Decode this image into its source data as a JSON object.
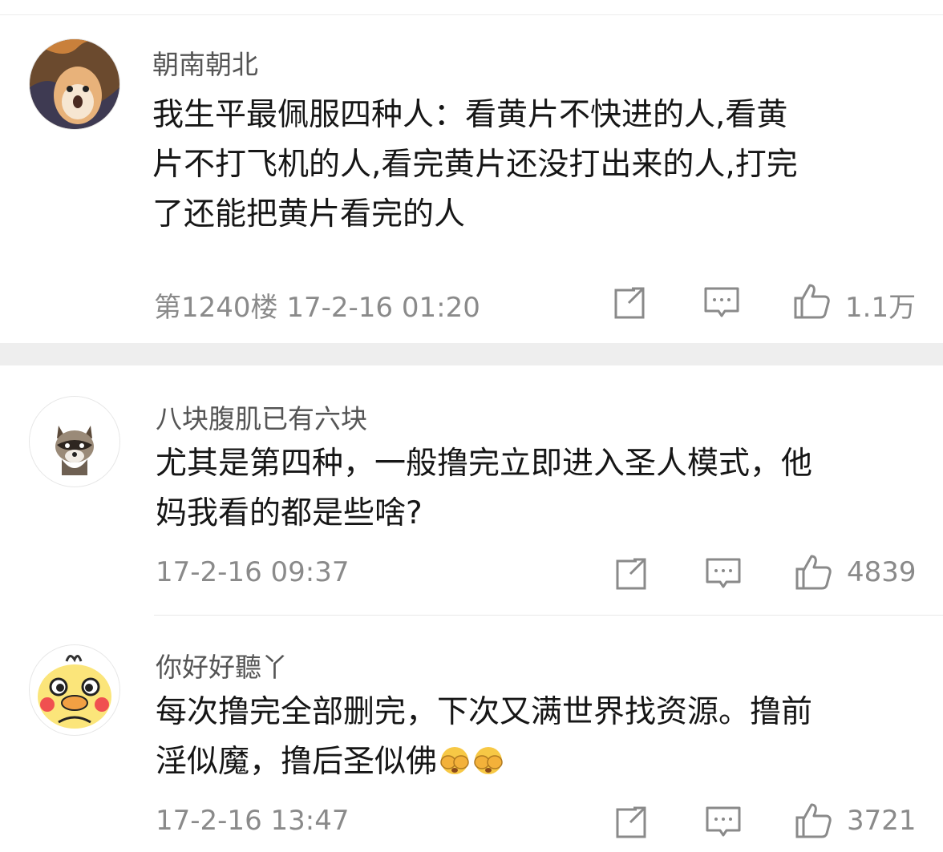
{
  "comments": [
    {
      "username": "朝南朝北",
      "lines": [
        "我生平最佩服四种人：看黄片不快进的人,看黄",
        "片不打飞机的人,看完黄片还没打出来的人,打完",
        "了还能把黄片看完的人"
      ],
      "floor": "第1240楼",
      "timestamp": "17-2-16 01:20",
      "likes": "1.1万",
      "avatar_icon": "hamster-avatar"
    },
    {
      "username": "八块腹肌已有六块",
      "lines": [
        "尤其是第四种，一般撸完立即进入圣人模式，他",
        "妈我看的都是些啥?"
      ],
      "timestamp": "17-2-16 09:37",
      "likes": "4839",
      "avatar_icon": "raccoon-avatar"
    },
    {
      "username": "你好好聽丫",
      "lines": [
        "每次撸完全部删完，下次又满世界找资源。撸前",
        "淫似魔，撸后圣似佛"
      ],
      "timestamp": "17-2-16 13:47",
      "likes": "3721",
      "avatar_icon": "duck-avatar",
      "emoji_icon": "face-covering-emoji"
    }
  ],
  "action_icons": [
    "share-icon",
    "comment-icon",
    "like-icon"
  ],
  "colors": {
    "meta_text": "#8a8a8a",
    "separator": "#eeeeee"
  }
}
